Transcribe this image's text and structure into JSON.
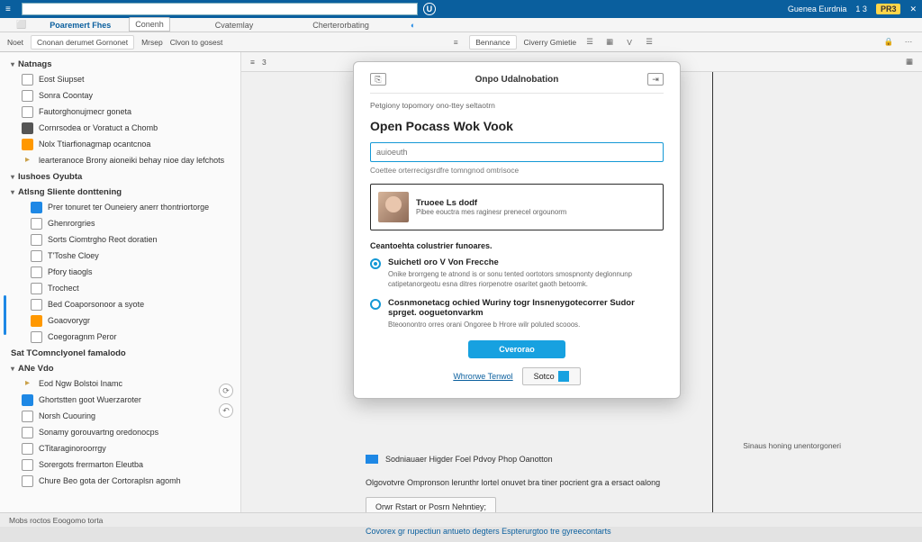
{
  "titlebar": {
    "menu_left": "≡",
    "search_placeholder": "",
    "circle_label": "U",
    "account_label": "Guenea Eurdnia",
    "account_count": "1 3",
    "badge": "PR3",
    "close": "✕"
  },
  "ribbon_tabs": {
    "t1": "⬜",
    "t2": "Poaremert Fhes",
    "t3": "Conenh",
    "t4": "Cvatemlay",
    "t5": "Cherterorbating",
    "circ": "◐"
  },
  "ribbon_groups": {
    "g1": "Noet",
    "g2": "Cnonan derumet Gornonet",
    "g3": "Mrsep",
    "g4": "Clvon to gosest",
    "r_icon1": "≡",
    "btn": "Bennance",
    "g5": "Civerry Gmietie",
    "r_icon2": "☰",
    "r_icon3": "▦",
    "r_icon4": "V",
    "r_icon5": "☰",
    "lock": "🔒",
    "dots": "⋯"
  },
  "sidebar": {
    "sec1": "Natnags",
    "items1": [
      {
        "icon": "box",
        "label": "Eost Siupset"
      },
      {
        "icon": "box",
        "label": "Sonra Coontay"
      },
      {
        "icon": "box",
        "label": "Fautorghonujmecr goneta"
      },
      {
        "icon": "dark",
        "label": "Cornrsodea or Voratuct a Chomb"
      },
      {
        "icon": "orange",
        "label": "Nolx  Ttiarfionagmap ocantcnoa"
      },
      {
        "icon": "folder",
        "label": "learteranoce Brony aioneiki behay nioe day lefchots"
      }
    ],
    "sec2": "Iushoes   Oyubta",
    "sec3": "Atlsng Sliente donttening",
    "items2": [
      {
        "icon": "blue",
        "label": "Prer tonuret ter Ouneiery anerr thontriortorge"
      },
      {
        "icon": "box",
        "label": "Ghenrorgries"
      },
      {
        "icon": "box",
        "label": "Sorts Ciomtrgho Reot doratien"
      },
      {
        "icon": "box",
        "label": "T'Toshe Cloey"
      },
      {
        "icon": "box",
        "label": "Pfory tiaogls"
      },
      {
        "icon": "box",
        "label": "Trochect"
      },
      {
        "icon": "box",
        "label": "Bed Coaporsonoor a syote"
      },
      {
        "icon": "orange",
        "label": "Goaovorygr"
      },
      {
        "icon": "box",
        "label": "Coegoragnm Peror"
      }
    ],
    "sec4": "Sat  TComnclyonel famalodo",
    "sec5": "ANe Vdo",
    "items3": [
      {
        "icon": "folder",
        "label": "Eod Ngw Bolstoi Inamc"
      },
      {
        "icon": "blue",
        "label": "Ghortstten goot Wuerzaroter"
      },
      {
        "icon": "box",
        "label": "Norsh Cuouring"
      },
      {
        "icon": "box",
        "label": "Sonamy gorouvartng oredonocps"
      },
      {
        "icon": "box",
        "label": "CTitaraginoroorrgy"
      },
      {
        "icon": "box",
        "label": "Sorergots frermarton Eleutba"
      },
      {
        "icon": "box",
        "label": "Chure Beo gota der Cortoraplsn agomh"
      }
    ],
    "refresh": "⟳",
    "history": "↶"
  },
  "contentbar": {
    "lbl1": "≡",
    "lbl2": "3",
    "lbl3": "▦",
    "right_text": "Sinaus honing unentorgoneri"
  },
  "below": {
    "line1": "Sodniauaer Higder Foel Pdvoy Phop Oanotton",
    "line2": "Olgovotvre Ompronson lerunthr lortel onuvet bra tiner pocrient gra a ersact oalong",
    "btn": "Orwr Rstart or Posrn Nehntiey;",
    "link": "Covorex gr rupectiun antueto degters Espterurgtoo tre gyreecontarts"
  },
  "modal": {
    "header_icon1": "⎘",
    "title": "Onpo Udalnobation",
    "header_icon2": "⇥",
    "subtitle": "Petgiony topomory ono-ttey seltaotrn",
    "heading": "Open Pocass Wok Vook",
    "input_placeholder": "auioeuth",
    "hint": "Coettee orterrecigsrdfre tomngnod omtrisoce",
    "card_title": "Truoee Ls dodf",
    "card_sub": "Pibee eouctra mes raginesr prenecel orgounorm",
    "section": "Ceantoehta colustrier funoares.",
    "opt1_title": "Suichetl oro V Von Frecche",
    "opt1_desc": "Onike brorrgeng te atnond is or sonu tented oortotors smospnonty deglonnunp catipetanorgeotu esna ditres riorpenotre osaritet gaoth betoomk.",
    "opt2_title": "Cosnmonetacg ochied Wuriny togr Insnenygotecorrer Sudor sprget. ooguetonvarkm",
    "opt2_desc": "Bteoonontro orres orani Ongoree b Hrore wilr poluted scooos.",
    "primary": "Cverorao",
    "footer_link": "Whrorwe Tenwol",
    "footer_btn": "Sotco"
  },
  "statusbar": {
    "text": "Mobs roctos Eoogomo torta"
  }
}
